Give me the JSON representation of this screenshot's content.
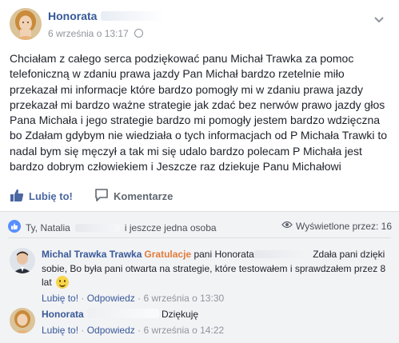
{
  "post": {
    "author": "Honorata",
    "timestamp": "6 września o 13:17",
    "text": "Chciałam z całego serca podziękować panu Michał Trawka za pomoc telefoniczną w zdaniu prawa jazdy Pan Michał bardzo rzetelnie miło przekazał mi informacje które bardzo pomogły mi w zdaniu prawa jazdy przekazał mi bardzo ważne strategie jak zdać bez nerwów prawo jazdy głos Pana Michała i jego strategie bardzo mi pomogły jestem bardzo wdzięczna bo Zdałam gdybym nie wiedziała o tych informacjach od P Michała Trawki to nadal bym się męczył a tak mi się udalo bardzo polecam P Michała jest bardzo dobrym człowiekiem i Jeszcze raz dziekuje Panu Michałowi"
  },
  "actions": {
    "like_label": "Lubię to!",
    "comment_label": "Komentarze"
  },
  "reactions": {
    "who": "Ty, Natalia",
    "who_suffix": "i jeszcze jedna osoba",
    "views": "Wyświetlone przez: 16"
  },
  "comments": [
    {
      "author": "Michal Trawka Trawka",
      "badge": "Gratulacje",
      "text_prefix": "pani Honorata",
      "text": "Zdała pani dzięki sobie, Bo była pani otwarta na strategie, które testowałem i sprawdzałem przez 8 lat",
      "like": "Lubię to!",
      "reply": "Odpowiedz",
      "time": "6 września o 13:30"
    },
    {
      "author": "Honorata",
      "text": "Dziękuję",
      "like": "Lubię to!",
      "reply": "Odpowiedz",
      "time": "6 września o 14:22"
    }
  ],
  "colors": {
    "link_blue": "#365899",
    "like_blue": "#4b67a1",
    "gratulacje_orange": "#e07b3a",
    "meta_gray": "#90949c"
  },
  "icons": [
    "globe-icon",
    "chevron-down-icon",
    "thumbs-up-icon",
    "comment-icon",
    "reaction-like-icon",
    "eye-icon",
    "smiley-icon"
  ]
}
